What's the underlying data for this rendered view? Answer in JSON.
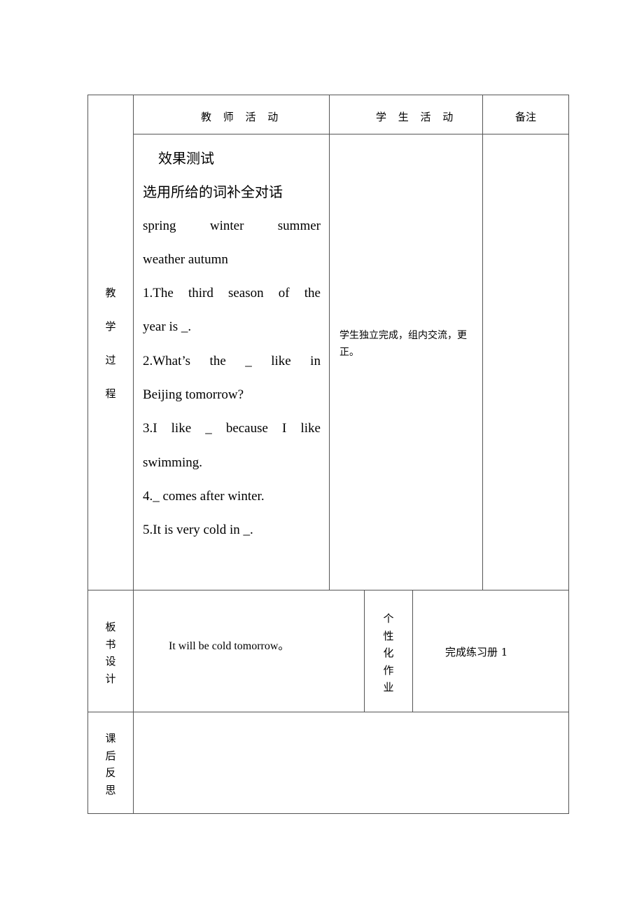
{
  "table": {
    "header": {
      "teacher_activity": "教 师 活 动",
      "student_activity": "学 生 活 动",
      "remarks": "备注"
    },
    "teaching_process": {
      "side_label": [
        "教",
        "学",
        "过",
        "程"
      ],
      "section_title": "效果测试",
      "instruction": "选用所给的词补全对话",
      "word_bank_line1": [
        "spring",
        "winter",
        "summer"
      ],
      "word_bank_line2": "weather autumn",
      "questions": [
        {
          "line1": [
            "1.The",
            "third",
            "season",
            "of",
            "the"
          ],
          "line2": "year is _."
        },
        {
          "line1": [
            "2.What’s",
            "the",
            "_",
            "like",
            "in"
          ],
          "line2": "Beijing tomorrow?"
        },
        {
          "line1": [
            "3.I",
            "like",
            "_",
            "because",
            "I",
            "like"
          ],
          "line2": "swimming."
        },
        {
          "line1": "4._ comes after winter."
        },
        {
          "line1": "5.It is very cold in _."
        }
      ],
      "student_note": "学生独立完成，组内交流，更正。",
      "remarks": ""
    },
    "board_design": {
      "side_label": [
        "板",
        "书",
        "设",
        "计"
      ],
      "content": "It will be cold tomorrow。"
    },
    "personal_homework": {
      "label": [
        "个",
        "性",
        "化",
        "作",
        "业"
      ],
      "content": "完成练习册 1"
    },
    "reflection": {
      "side_label": [
        "课",
        "后",
        "反",
        "思"
      ],
      "content": ""
    }
  }
}
